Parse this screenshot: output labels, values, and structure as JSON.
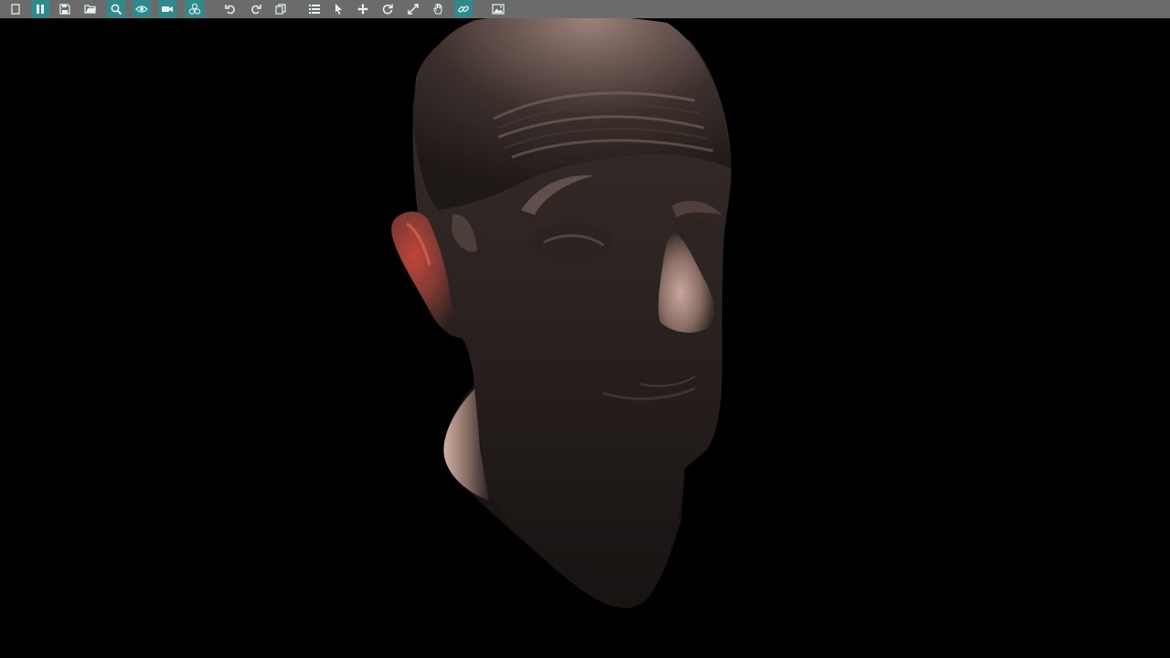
{
  "app": {
    "toolbar": {
      "background": "#6b6b6b",
      "active_color": "#2f8a8e",
      "icon_color": "#e6f2f2",
      "buttons": [
        {
          "icon": "blank-page-icon",
          "tooltip": ""
        },
        {
          "icon": "pause-icon",
          "tooltip": ""
        },
        {
          "icon": "save-icon",
          "tooltip": ""
        },
        {
          "icon": "folder-open-icon",
          "tooltip": ""
        },
        {
          "icon": "search-icon",
          "tooltip": ""
        },
        {
          "icon": "eye-icon",
          "tooltip": ""
        },
        {
          "icon": "camera-icon",
          "tooltip": ""
        },
        {
          "icon": "layers-icon",
          "tooltip": ""
        },
        {
          "icon": "undo-icon",
          "tooltip": ""
        },
        {
          "icon": "redo-icon",
          "tooltip": ""
        },
        {
          "icon": "copy-icon",
          "tooltip": ""
        },
        {
          "icon": "list-icon",
          "tooltip": ""
        },
        {
          "icon": "select-pointer-icon",
          "tooltip": ""
        },
        {
          "icon": "move-icon",
          "tooltip": ""
        },
        {
          "icon": "rotate-icon",
          "tooltip": ""
        },
        {
          "icon": "scale-icon",
          "tooltip": ""
        },
        {
          "icon": "hand-pan-icon",
          "tooltip": ""
        },
        {
          "icon": "link-icon",
          "tooltip": ""
        },
        {
          "icon": "image-icon",
          "tooltip": ""
        }
      ]
    },
    "viewport": {
      "background": "#000000",
      "model": "human-head-3d-model"
    }
  }
}
